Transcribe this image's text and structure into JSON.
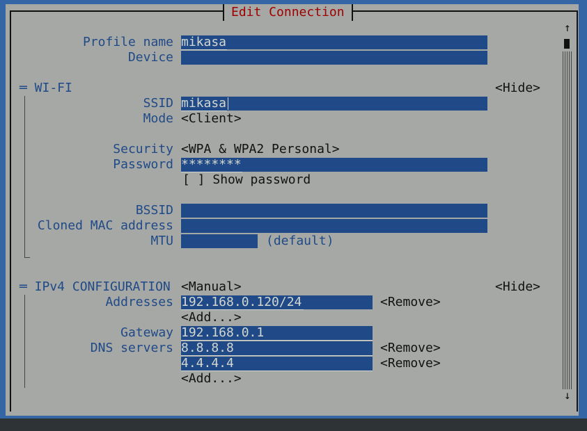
{
  "dialog": {
    "title": "Edit Connection"
  },
  "profile": {
    "profile_name_label": "Profile name",
    "profile_name_value": "mikasa",
    "device_label": "Device",
    "device_value": ""
  },
  "wifi": {
    "header": "═ WI-FI",
    "hide_label": "<Hide>",
    "ssid_label": "SSID",
    "ssid_value": "mikasa",
    "mode_label": "Mode",
    "mode_value": "<Client>",
    "security_label": "Security",
    "security_value": "<WPA & WPA2 Personal>",
    "password_label": "Password",
    "password_value": "********",
    "show_password_checkbox": "[ ]",
    "show_password_label": "Show password",
    "bssid_label": "BSSID",
    "bssid_value": "",
    "cloned_mac_label": "Cloned MAC address",
    "cloned_mac_value": "",
    "mtu_label": "MTU",
    "mtu_value": "",
    "mtu_default": "(default)"
  },
  "ipv4": {
    "header": "═ IPv4 CONFIGURATION",
    "method_value": "<Manual>",
    "hide_label": "<Hide>",
    "addresses_label": "Addresses",
    "addresses": [
      "192.168.0.120/24"
    ],
    "remove_label": "<Remove>",
    "add_label": "<Add...>",
    "gateway_label": "Gateway",
    "gateway_value": "192.168.0.1",
    "dns_label": "DNS servers",
    "dns": [
      "8.8.8.8",
      "4.4.4.4"
    ]
  },
  "scrollbar": {
    "up_arrow": "↑",
    "down_arrow": "↓"
  }
}
